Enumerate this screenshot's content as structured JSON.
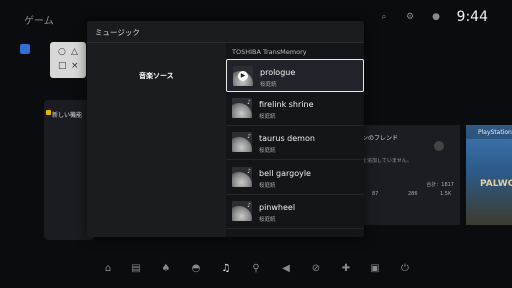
{
  "topbar": {
    "game_label": "ゲーム",
    "clock": "9:44",
    "icons": [
      "search-icon",
      "gear-icon",
      "profile-icon"
    ]
  },
  "home": {
    "tile_symbols": [
      "○",
      "△",
      "□",
      "×"
    ],
    "left_card_label": "新しい機能",
    "friend_panel": {
      "title": "ンのフレンド",
      "subtitle": "を追加していません。",
      "total_label": "合計：1817",
      "stats": [
        "87",
        "286",
        "1.5K"
      ]
    },
    "game_card": {
      "caption": "PlayStation",
      "word": "PALWO"
    },
    "bottom_icons": [
      "home-icon",
      "store-icon",
      "bell-icon",
      "ps-icon",
      "music-icon",
      "mic-icon",
      "volume-icon",
      "mic-mute-icon",
      "controller-icon",
      "chat-icon",
      "power-icon"
    ]
  },
  "music_panel": {
    "title": "ミュージック",
    "source_label": "音楽ソース",
    "device_name": "TOSHIBA TransMemory",
    "tracks": [
      {
        "name": "prologue",
        "artist": "桜庭統",
        "selected": true
      },
      {
        "name": "firelink shrine",
        "artist": "桜庭統",
        "selected": false
      },
      {
        "name": "taurus demon",
        "artist": "桜庭統",
        "selected": false
      },
      {
        "name": "bell gargoyle",
        "artist": "桜庭統",
        "selected": false
      },
      {
        "name": "pinwheel",
        "artist": "桜庭統",
        "selected": false
      }
    ],
    "play_symbol": "▶",
    "note_symbol": "♪"
  }
}
